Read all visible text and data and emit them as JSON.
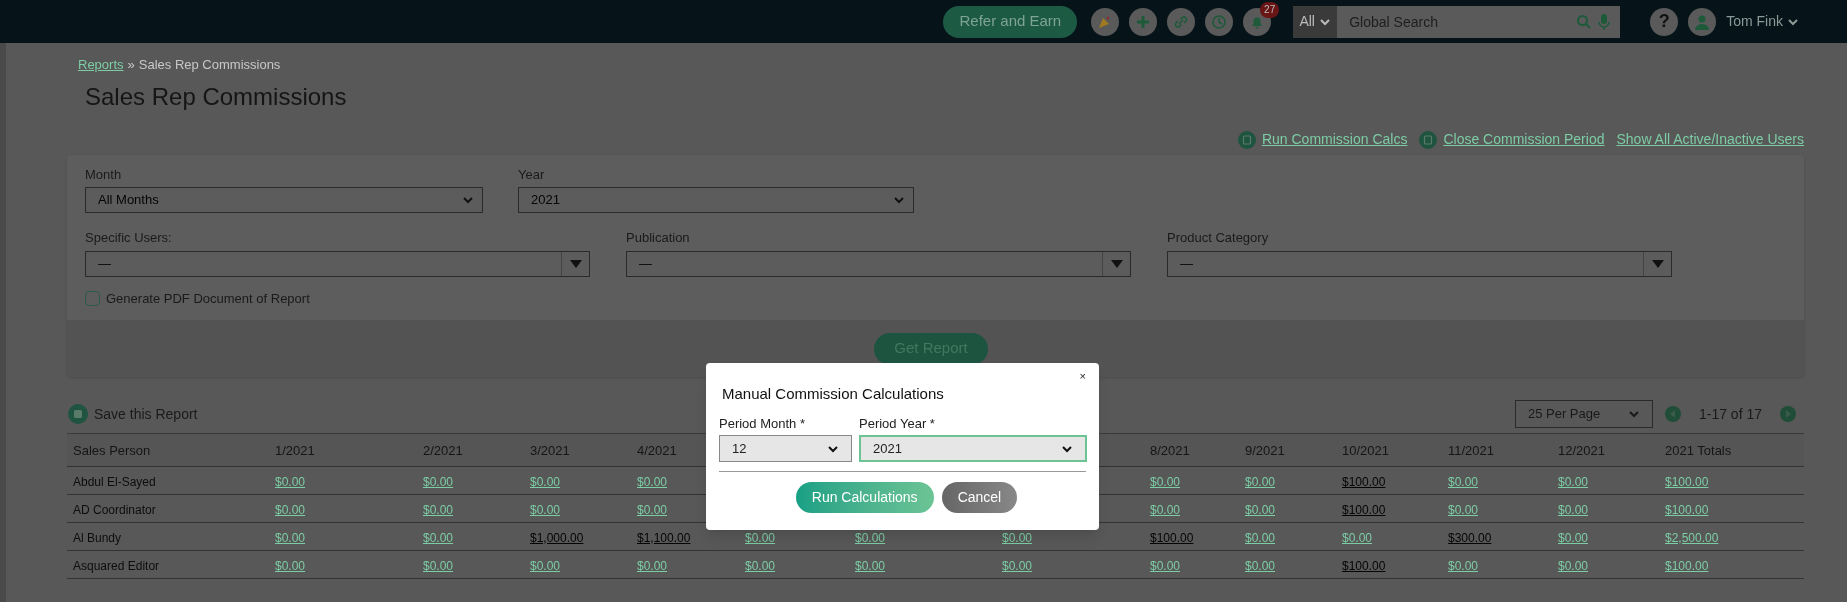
{
  "top_bar": {
    "refer_button": "Refer and Earn",
    "notification_count": "27",
    "search_scope": "All",
    "search_placeholder": "Global Search",
    "help": "?",
    "user_name": "Tom Fink"
  },
  "breadcrumb": {
    "link": "Reports",
    "separator": "»",
    "current": "Sales Rep Commissions"
  },
  "page_title": "Sales Rep Commissions",
  "actions": [
    {
      "kind": "icon",
      "label": "Run Commission Calcs"
    },
    {
      "kind": "icon",
      "label": "Close Commission Period"
    },
    {
      "kind": "plain",
      "label": "Show All Active/Inactive Users"
    }
  ],
  "filters": {
    "month": {
      "label": "Month",
      "value": "All Months"
    },
    "year": {
      "label": "Year",
      "value": "2021"
    },
    "specific_users": {
      "label": "Specific Users:",
      "value": "—"
    },
    "publication": {
      "label": "Publication",
      "value": "—"
    },
    "product_category": {
      "label": "Product Category",
      "value": "—"
    },
    "pdf_option": {
      "label": "Generate PDF Document of Report",
      "checked": false
    },
    "submit": "Get Report"
  },
  "save_report": "Save this Report",
  "pagination": {
    "per_page": "25 Per Page",
    "range": "1-17 of 17"
  },
  "table": {
    "columns": [
      "Sales Person",
      "1/2021",
      "2/2021",
      "3/2021",
      "4/2021",
      null,
      null,
      null,
      "8/2021",
      "9/2021",
      "10/2021",
      "11/2021",
      "12/2021",
      "2021 Totals"
    ],
    "rows": [
      {
        "cells": [
          "Abdul El-Sayed",
          {
            "t": "$0.00",
            "dark": false
          },
          {
            "t": "$0.00",
            "dark": false
          },
          {
            "t": "$0.00",
            "dark": false
          },
          {
            "t": "$0.00",
            "dark": false
          },
          null,
          null,
          null,
          {
            "t": "$0.00",
            "dark": false
          },
          {
            "t": "$0.00",
            "dark": false
          },
          {
            "t": "$100.00",
            "dark": true
          },
          {
            "t": "$0.00",
            "dark": false
          },
          {
            "t": "$0.00",
            "dark": false
          },
          {
            "t": "$100.00",
            "dark": false
          }
        ]
      },
      {
        "cells": [
          "AD Coordinator",
          {
            "t": "$0.00",
            "dark": false
          },
          {
            "t": "$0.00",
            "dark": false
          },
          {
            "t": "$0.00",
            "dark": false
          },
          {
            "t": "$0.00",
            "dark": false
          },
          null,
          null,
          null,
          {
            "t": "$0.00",
            "dark": false
          },
          {
            "t": "$0.00",
            "dark": false
          },
          {
            "t": "$100.00",
            "dark": true
          },
          {
            "t": "$0.00",
            "dark": false
          },
          {
            "t": "$0.00",
            "dark": false
          },
          {
            "t": "$100.00",
            "dark": false
          }
        ]
      },
      {
        "cells": [
          "Al Bundy",
          {
            "t": "$0.00",
            "dark": false
          },
          {
            "t": "$0.00",
            "dark": false
          },
          {
            "t": "$1,000.00",
            "dark": true
          },
          {
            "t": "$1,100.00",
            "dark": true
          },
          {
            "t": "$0.00",
            "dark": false
          },
          {
            "t": "$0.00",
            "dark": false
          },
          {
            "t": "$0.00",
            "dark": false
          },
          {
            "t": "$100.00",
            "dark": true
          },
          {
            "t": "$0.00",
            "dark": false
          },
          {
            "t": "$0.00",
            "dark": false
          },
          {
            "t": "$300.00",
            "dark": true
          },
          {
            "t": "$0.00",
            "dark": false
          },
          {
            "t": "$2,500.00",
            "dark": false
          }
        ]
      },
      {
        "cells": [
          "Asquared Editor",
          {
            "t": "$0.00",
            "dark": false
          },
          {
            "t": "$0.00",
            "dark": false
          },
          {
            "t": "$0.00",
            "dark": false
          },
          {
            "t": "$0.00",
            "dark": false
          },
          {
            "t": "$0.00",
            "dark": false
          },
          {
            "t": "$0.00",
            "dark": false
          },
          {
            "t": "$0.00",
            "dark": false
          },
          {
            "t": "$0.00",
            "dark": false
          },
          {
            "t": "$0.00",
            "dark": false
          },
          {
            "t": "$100.00",
            "dark": true
          },
          {
            "t": "$0.00",
            "dark": false
          },
          {
            "t": "$0.00",
            "dark": false
          },
          {
            "t": "$100.00",
            "dark": false
          }
        ]
      }
    ]
  },
  "dialog": {
    "title": "Manual Commission Calculations",
    "close": "×",
    "month": {
      "label": "Period Month *",
      "value": "12",
      "focused": false
    },
    "year": {
      "label": "Period Year *",
      "value": "2021",
      "focused": true
    },
    "buttons": [
      {
        "kind": "primary",
        "label": "Run Calculations"
      },
      {
        "kind": "secondary",
        "label": "Cancel"
      }
    ]
  }
}
